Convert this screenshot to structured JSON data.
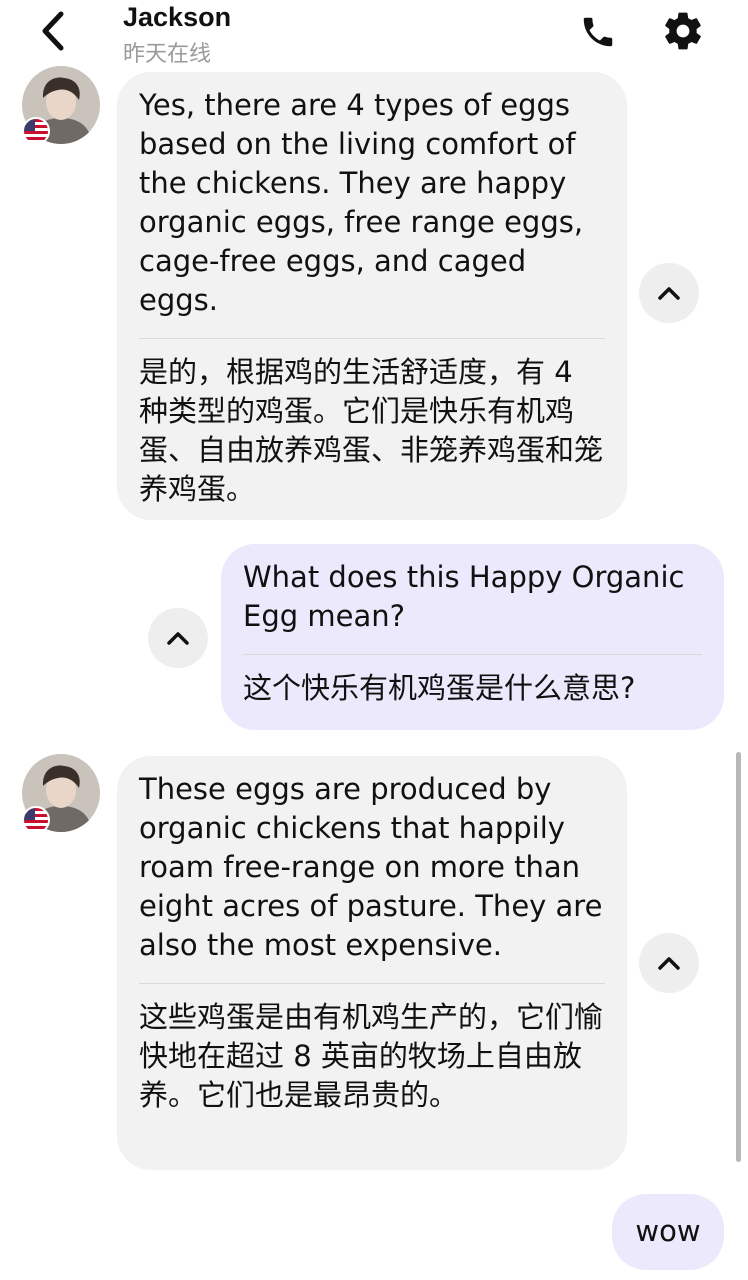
{
  "header": {
    "contact_name": "Jackson",
    "last_seen": "昨天在线"
  },
  "messages": [
    {
      "sender": "contact",
      "text_en": "Yes, there are 4 types of eggs based on the living comfort of the chickens. They are happy organic eggs, free range eggs, cage-free eggs, and caged eggs.",
      "text_zh": "是的，根据鸡的生活舒适度，有 4 种类型的鸡蛋。它们是快乐有机鸡蛋、自由放养鸡蛋、非笼养鸡蛋和笼养鸡蛋。"
    },
    {
      "sender": "me",
      "text_en": "What does this Happy Organic Egg mean?",
      "text_zh": "这个快乐有机鸡蛋是什么意思?"
    },
    {
      "sender": "contact",
      "text_en": "These eggs are produced by organic chickens that happily roam free-range on more than eight acres of pasture. They are also the most expensive.",
      "text_zh": "这些鸡蛋是由有机鸡生产的，它们愉快地在超过 8 英亩的牧场上自由放养。它们也是最昂贵的。"
    },
    {
      "sender": "me",
      "text_en": "wow"
    }
  ],
  "icons": {
    "back": "chevron-left-icon",
    "call": "phone-icon",
    "settings": "gear-icon",
    "collapse": "chevron-up-icon",
    "flag": "us-flag-icon"
  },
  "colors": {
    "incoming_bubble": "#f2f2f3",
    "outgoing_bubble": "#ebe9fb",
    "muted_text": "#9a9a9a"
  }
}
